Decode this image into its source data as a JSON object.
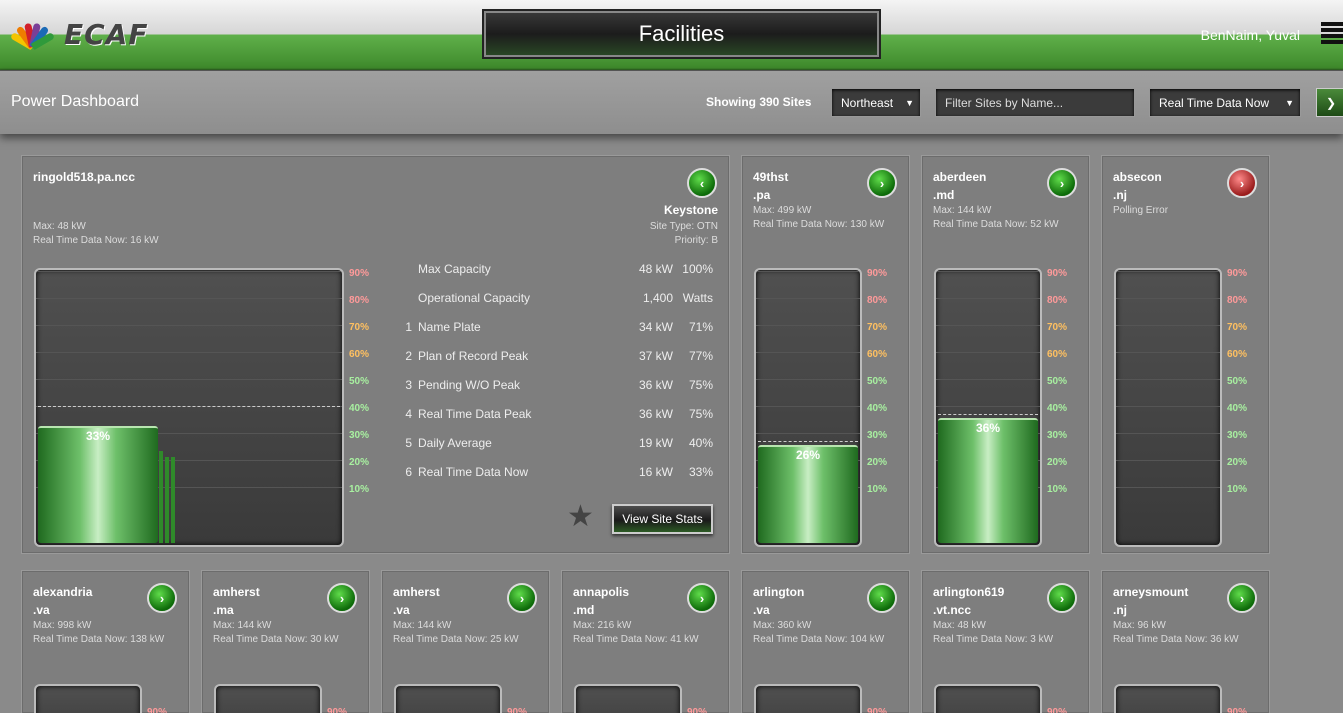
{
  "header": {
    "logo_text": "ECAF",
    "title": "Facilities",
    "user": "BenNaim, Yuval"
  },
  "subheader": {
    "title": "Power Dashboard",
    "showing": "Showing 390 Sites",
    "region": "Northeast",
    "filter_placeholder": "Filter Sites by Name...",
    "data_mode": "Real Time Data Now"
  },
  "scale_labels": [
    "90%",
    "80%",
    "70%",
    "60%",
    "50%",
    "40%",
    "30%",
    "20%",
    "10%"
  ],
  "featured": {
    "name": "ringold518.pa.ncc",
    "max": "Max: 48 kW",
    "rtd": "Real Time Data Now: 16 kW",
    "region": "Keystone",
    "site_type": "Site Type: OTN",
    "priority": "Priority: B",
    "fill_percent": 33,
    "fill_label": "33%",
    "marker_percent": 40,
    "rows": [
      {
        "num": "",
        "label": "Max Capacity",
        "kw": "48 kW",
        "pct": "100%"
      },
      {
        "num": "",
        "label": "Operational Capacity",
        "kw": "1,400",
        "pct": "Watts"
      },
      {
        "num": "1",
        "label": "Name Plate",
        "kw": "34 kW",
        "pct": "71%"
      },
      {
        "num": "2",
        "label": "Plan of Record Peak",
        "kw": "37 kW",
        "pct": "77%"
      },
      {
        "num": "3",
        "label": "Pending W/O Peak",
        "kw": "36 kW",
        "pct": "75%"
      },
      {
        "num": "4",
        "label": "Real Time Data Peak",
        "kw": "36 kW",
        "pct": "75%"
      },
      {
        "num": "5",
        "label": "Daily Average",
        "kw": "19 kW",
        "pct": "40%"
      },
      {
        "num": "6",
        "label": "Real Time Data Now",
        "kw": "16 kW",
        "pct": "33%"
      }
    ],
    "view_label": "View Site Stats"
  },
  "sites_row1": [
    {
      "name": "49thst\n.pa",
      "max": "Max: 499 kW",
      "rtd": "Real Time Data Now: 130 kW",
      "status": "ok",
      "fill_percent": 26,
      "fill_label": "26%"
    },
    {
      "name": "aberdeen\n.md",
      "max": "Max: 144 kW",
      "rtd": "Real Time Data Now: 52 kW",
      "status": "ok",
      "fill_percent": 36,
      "fill_label": "36%"
    },
    {
      "name": "absecon\n.nj",
      "max": "Polling Error",
      "rtd": "",
      "status": "err",
      "fill_percent": 0,
      "fill_label": ""
    }
  ],
  "sites_row2": [
    {
      "name": "alexandria\n.va",
      "max": "Max: 998 kW",
      "rtd": "Real Time Data Now: 138 kW"
    },
    {
      "name": "amherst\n.ma",
      "max": "Max: 144 kW",
      "rtd": "Real Time Data Now: 30 kW"
    },
    {
      "name": "amherst\n.va",
      "max": "Max: 144 kW",
      "rtd": "Real Time Data Now: 25 kW"
    },
    {
      "name": "annapolis\n.md",
      "max": "Max: 216 kW",
      "rtd": "Real Time Data Now: 41 kW"
    },
    {
      "name": "arlington\n.va",
      "max": "Max: 360 kW",
      "rtd": "Real Time Data Now: 104 kW"
    },
    {
      "name": "arlington619\n.vt.ncc",
      "max": "Max: 48 kW",
      "rtd": "Real Time Data Now: 3 kW"
    },
    {
      "name": "arneysmount\n.nj",
      "max": "Max: 96 kW",
      "rtd": "Real Time Data Now: 36 kW"
    }
  ],
  "colors": {
    "scale_90": "#ff9a9a",
    "scale_80": "#ff9a9a",
    "scale_70": "#ffc060",
    "scale_60": "#ffc060",
    "scale_50": "#a8f0a0",
    "scale_40": "#a8f0a0",
    "scale_30": "#a8f0a0",
    "scale_20": "#a8f0a0",
    "scale_10": "#a8f0a0"
  },
  "icons": {
    "nav_next": "chevron-right-icon",
    "nav_back": "chevron-left-icon",
    "favorite": "star-icon",
    "menu": "hamburger-menu-icon"
  }
}
